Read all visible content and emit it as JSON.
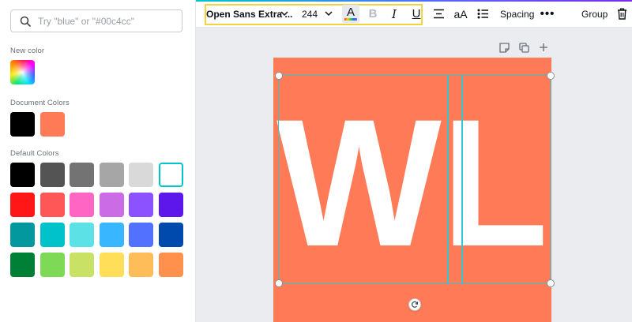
{
  "search": {
    "placeholder": "Try \"blue\" or \"#00c4cc\""
  },
  "sections": {
    "new_color": "New color",
    "document_colors": "Document Colors",
    "default_colors": "Default Colors"
  },
  "document_colors": [
    "#000000",
    "#ff7b57"
  ],
  "default_colors": [
    [
      "#000000",
      "#545454",
      "#737373",
      "#a6a6a6",
      "#d9d9d9",
      "#ffffff"
    ],
    [
      "#ff1616",
      "#ff5757",
      "#ff66c4",
      "#cb6ce6",
      "#8c52ff",
      "#5e17eb"
    ],
    [
      "#03989e",
      "#00c2cb",
      "#5ce1e6",
      "#38b6ff",
      "#5271ff",
      "#004aad"
    ],
    [
      "#008037",
      "#7ed957",
      "#c9e265",
      "#ffde59",
      "#ffbd59",
      "#ff914d"
    ]
  ],
  "selected_default_color": "#ffffff",
  "toolbar": {
    "font_name": "Open Sans Extra ...",
    "font_size": "244",
    "text_color_letter": "A",
    "bold": "B",
    "italic": "I",
    "underline": "U",
    "case": "aA",
    "spacing": "Spacing",
    "more": "•••",
    "group": "Group"
  },
  "canvas": {
    "background": "#ff7b57",
    "text": "WL",
    "text_color": "#ffffff",
    "selection_color": "#32c7d0"
  },
  "icons": {
    "search": "search-icon",
    "chevron": "chevron-down-icon",
    "align": "align-center-icon",
    "list": "list-icon",
    "trash": "trash-icon",
    "note": "note-icon",
    "duplicate": "duplicate-icon",
    "add": "add-page-icon",
    "rotate": "rotate-icon"
  }
}
